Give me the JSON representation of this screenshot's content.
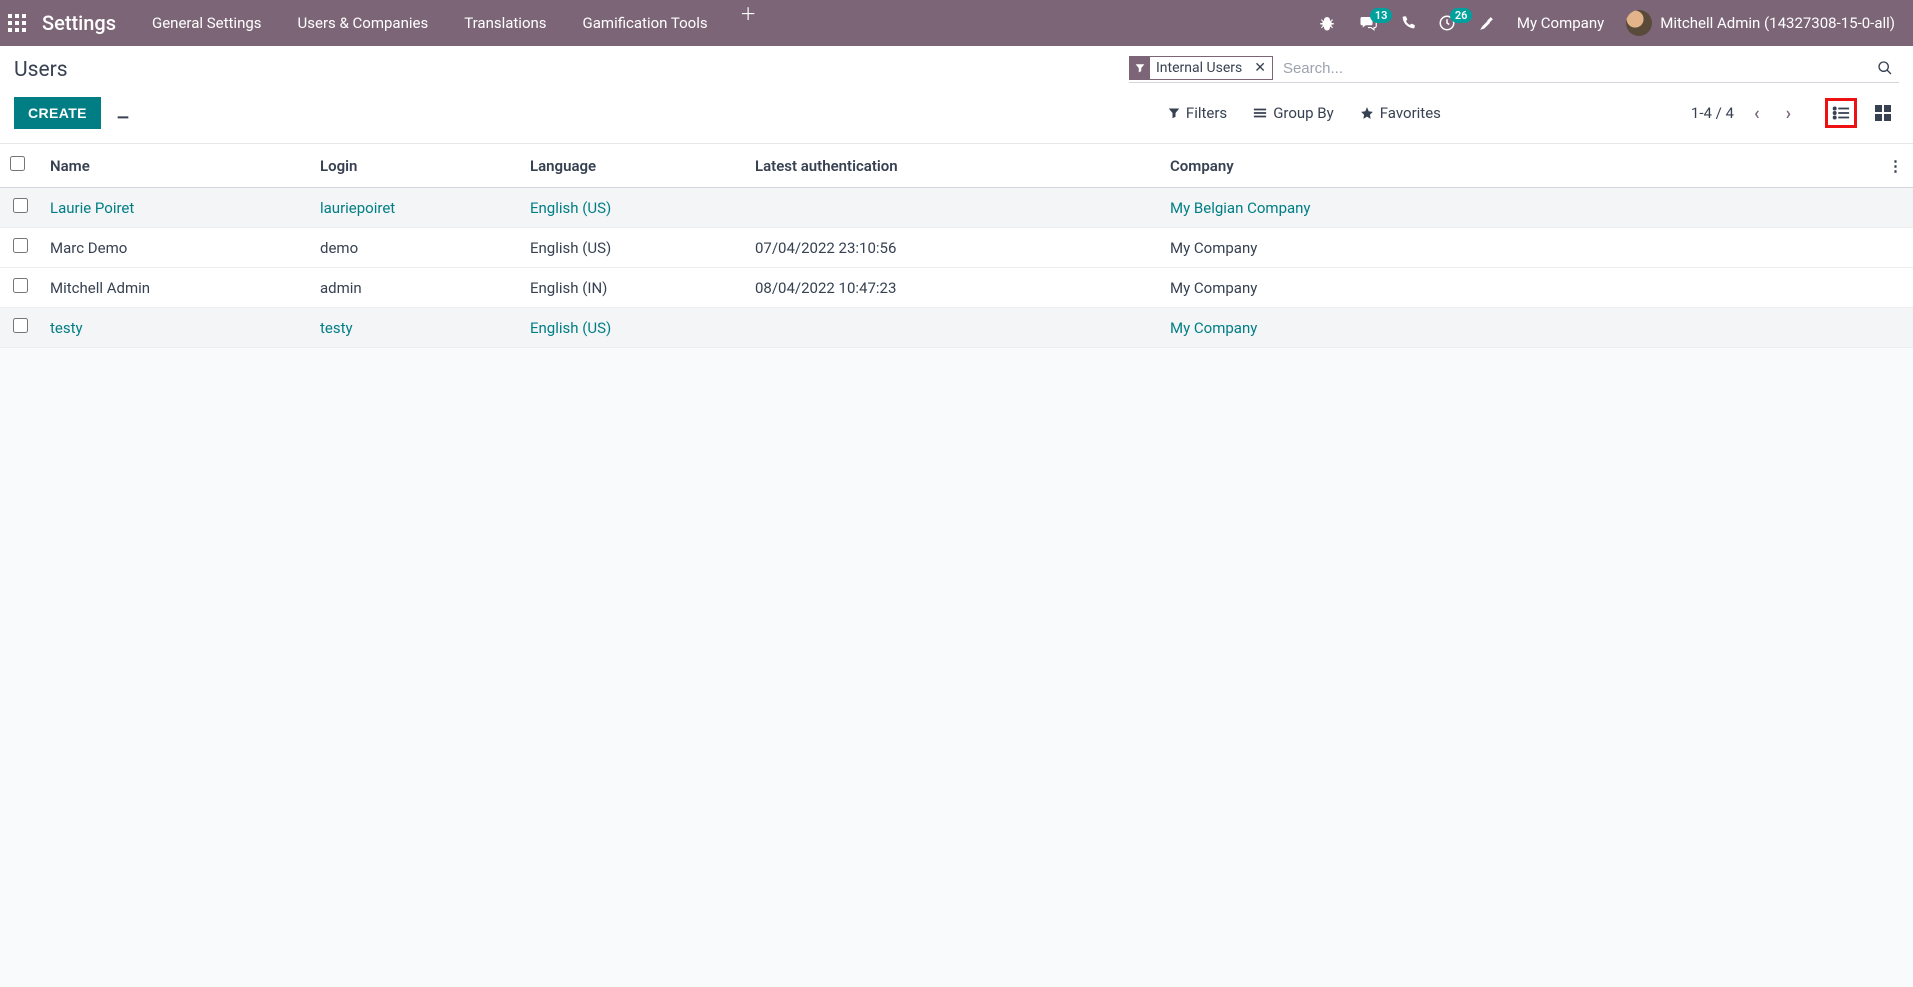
{
  "topnav": {
    "app_title": "Settings",
    "menu": [
      "General Settings",
      "Users & Companies",
      "Translations",
      "Gamification Tools"
    ],
    "messaging_badge": "13",
    "activity_badge": "26",
    "company": "My Company",
    "user": "Mitchell Admin (14327308-15-0-all)"
  },
  "breadcrumb": {
    "title": "Users"
  },
  "search": {
    "facet_label": "Internal Users",
    "placeholder": "Search..."
  },
  "buttons": {
    "create": "CREATE"
  },
  "search_options": {
    "filters": "Filters",
    "group_by": "Group By",
    "favorites": "Favorites"
  },
  "pager": {
    "text": "1-4 / 4"
  },
  "columns": {
    "name": "Name",
    "login": "Login",
    "language": "Language",
    "latest_auth": "Latest authentication",
    "company": "Company"
  },
  "rows": [
    {
      "name": "Laurie Poiret",
      "login": "lauriepoiret",
      "language": "English (US)",
      "latest_auth": "",
      "company": "My Belgian Company",
      "hovered": true
    },
    {
      "name": "Marc Demo",
      "login": "demo",
      "language": "English (US)",
      "latest_auth": "07/04/2022 23:10:56",
      "company": "My Company",
      "hovered": false
    },
    {
      "name": "Mitchell Admin",
      "login": "admin",
      "language": "English (IN)",
      "latest_auth": "08/04/2022 10:47:23",
      "company": "My Company",
      "hovered": false
    },
    {
      "name": "testy",
      "login": "testy",
      "language": "English (US)",
      "latest_auth": "",
      "company": "My Company",
      "hovered": true
    }
  ]
}
